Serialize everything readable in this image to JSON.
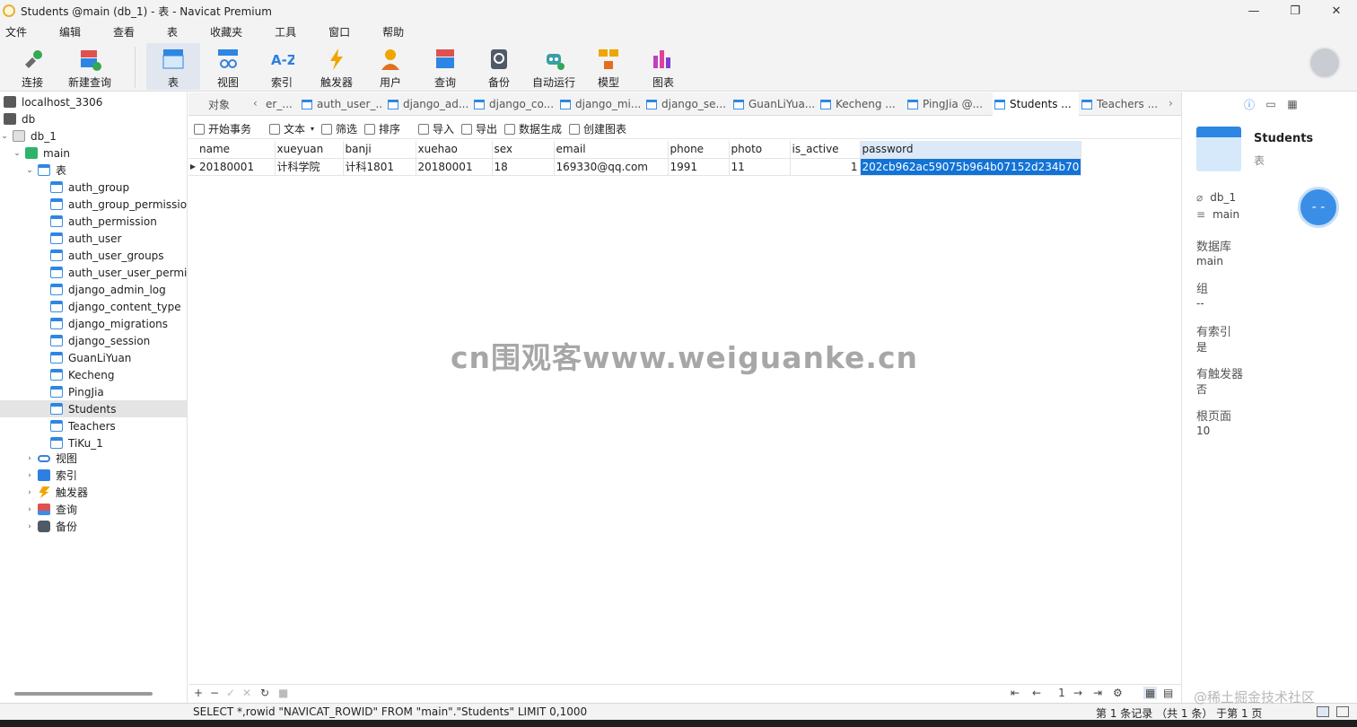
{
  "window": {
    "title": "Students @main (db_1) - 表 - Navicat Premium",
    "minimize": "—",
    "maximize": "❐",
    "close": "✕"
  },
  "menu": [
    "文件",
    "编辑",
    "查看",
    "表",
    "收藏夹",
    "工具",
    "窗口",
    "帮助"
  ],
  "toolbar": {
    "connect": "连接",
    "new_query": "新建查询",
    "table": "表",
    "view": "视图",
    "index": "索引",
    "trigger": "触发器",
    "user": "用户",
    "query": "查询",
    "backup": "备份",
    "automation": "自动运行",
    "model": "模型",
    "chart": "图表"
  },
  "tree": {
    "connection": "localhost_3306",
    "db": "db",
    "db1": "db_1",
    "schema": "main",
    "tables_folder": "表",
    "tables": [
      "auth_group",
      "auth_group_permission",
      "auth_permission",
      "auth_user",
      "auth_user_groups",
      "auth_user_user_permiss",
      "django_admin_log",
      "django_content_type",
      "django_migrations",
      "django_session",
      "GuanLiYuan",
      "Kecheng",
      "PingJia",
      "Students",
      "Teachers",
      "TiKu_1"
    ],
    "folders": [
      "视图",
      "索引",
      "触发器",
      "查询",
      "备份"
    ]
  },
  "tabs": {
    "objects": "对象",
    "items": [
      "er_...",
      "auth_user_...",
      "django_ad...",
      "django_co...",
      "django_mi...",
      "django_se...",
      "GuanLiYua...",
      "Kecheng ...",
      "PingJia @...",
      "Students ...",
      "Teachers ..."
    ]
  },
  "grid_toolbar": {
    "begin_tx": "开始事务",
    "text": "文本",
    "filter": "筛选",
    "sort": "排序",
    "import": "导入",
    "export": "导出",
    "data_gen": "数据生成",
    "create_chart": "创建图表"
  },
  "table": {
    "columns": [
      "name",
      "xueyuan",
      "banji",
      "xuehao",
      "sex",
      "email",
      "phone",
      "photo",
      "is_active",
      "password"
    ],
    "rows": [
      [
        "20180001",
        "计科学院",
        "计科1801",
        "20180001",
        "18",
        "169330@qq.com",
        "1991",
        "11",
        "1",
        "202cb962ac59075b964b07152d234b70"
      ]
    ]
  },
  "watermark": "cn围观客www.weiguanke.cn",
  "info_panel": {
    "name": "Students",
    "type": "表",
    "db": "db_1",
    "schema": "main",
    "fields": [
      {
        "label": "数据库",
        "value": "main"
      },
      {
        "label": "组",
        "value": "--"
      },
      {
        "label": "有索引",
        "value": "是"
      },
      {
        "label": "有触发器",
        "value": "否"
      },
      {
        "label": "根页面",
        "value": "10"
      }
    ]
  },
  "bottom_bar": {
    "page": "1"
  },
  "status": {
    "sql": "SELECT *,rowid \"NAVICAT_ROWID\" FROM \"main\".\"Students\" LIMIT 0,1000",
    "records": "第 1 条记录 （共 1 条） 于第 1 页"
  },
  "credit": "@稀土掘金技术社区",
  "colors": {
    "accent": "#1273d6",
    "folder_blue": "#2d86e3"
  }
}
